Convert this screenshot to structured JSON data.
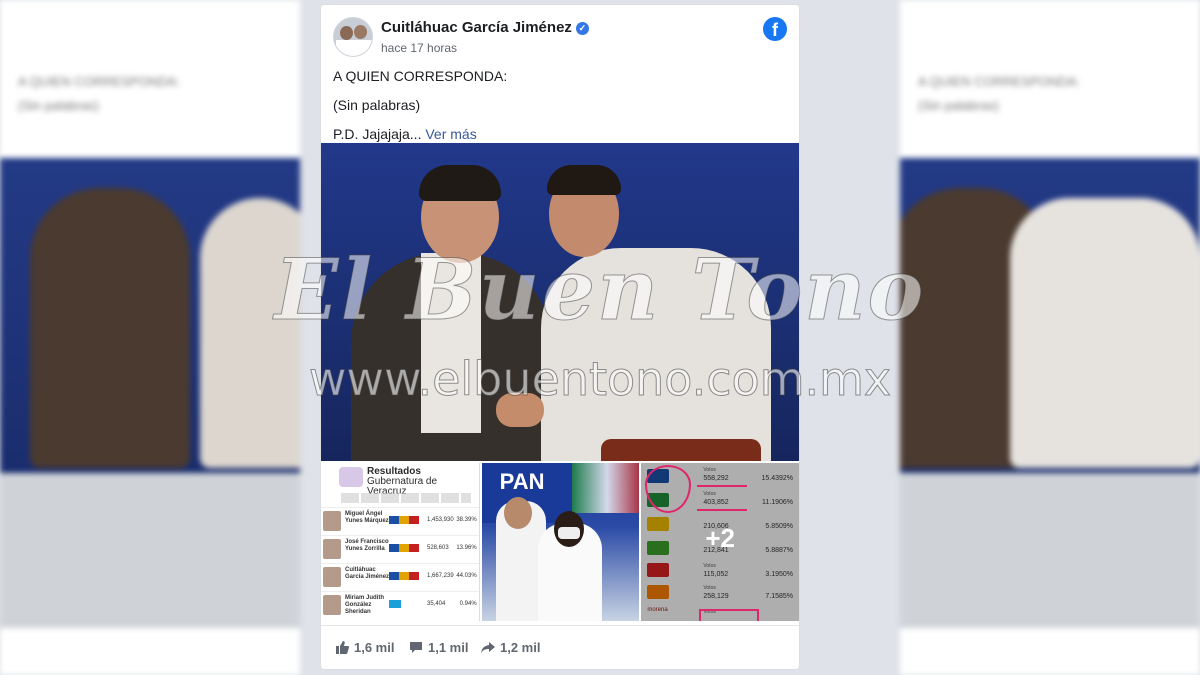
{
  "post": {
    "author": "Cuitláhuac García Jiménez",
    "time": "hace 17 horas",
    "text_line1": "A QUIEN CORRESPONDA:",
    "text_line2": "(Sin palabras)",
    "text_line3": "P.D. Jajajaja...",
    "see_more": "Ver más",
    "network_logo": "f"
  },
  "thumbnails": {
    "results": {
      "title": "Resultados",
      "subtitle": "Gubernatura de Veracruz",
      "rows": [
        {
          "name": "Miguel Ángel Yunes Márquez",
          "votes": "1,453,930",
          "pct": "38.39%"
        },
        {
          "name": "José Francisco Yunes Zorrilla",
          "votes": "528,603",
          "pct": "13.96%"
        },
        {
          "name": "Cuitláhuac García Jiménez",
          "votes": "1,667,239",
          "pct": "44.03%"
        },
        {
          "name": "Miriam Judith González Sheridan",
          "votes": "35,404",
          "pct": "0.94%"
        }
      ]
    },
    "rally": {
      "sign": "PAN"
    },
    "votes": {
      "label": "Votos",
      "rows": [
        {
          "votes": "558,292",
          "pct": "15.4392%"
        },
        {
          "votes": "403,852",
          "pct": "11.1906%"
        },
        {
          "votes": "210,606",
          "pct": "5.8509%"
        },
        {
          "votes": "212,841",
          "pct": "5.8887%"
        },
        {
          "votes": "115,052",
          "pct": "3.1950%"
        },
        {
          "votes": "258,129",
          "pct": "7.1585%"
        }
      ],
      "party_last": "morena",
      "more": "+2"
    }
  },
  "footer": {
    "likes": "1,6 mil",
    "comments": "1,1 mil",
    "shares": "1,2 mil"
  },
  "background_side": {
    "text_line1": "A QUIEN CORRESPONDA:",
    "text_line2": "(Sin palabras)",
    "text_line3": "P.D. Jajajaja...",
    "see_more": "Ver más"
  },
  "watermark": {
    "title": "El Buen Tono",
    "url": "www.elbuentono.com.mx"
  },
  "colors": {
    "facebook_blue": "#1877f2",
    "link": "#385898",
    "highlight": "#e0266b"
  }
}
